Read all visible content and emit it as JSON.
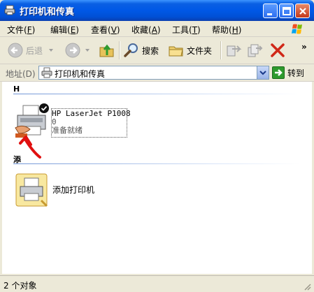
{
  "window": {
    "title": "打印机和传真",
    "controls": [
      "minimize",
      "maximize",
      "close"
    ]
  },
  "menu": {
    "items": [
      {
        "label": "文件(",
        "key": "F",
        "end": ")"
      },
      {
        "label": "编辑(",
        "key": "E",
        "end": ")"
      },
      {
        "label": "查看(",
        "key": "V",
        "end": ")"
      },
      {
        "label": "收藏(",
        "key": "A",
        "end": ")"
      },
      {
        "label": "工具(",
        "key": "T",
        "end": ")"
      },
      {
        "label": "帮助(",
        "key": "H",
        "end": ")"
      }
    ]
  },
  "toolbar": {
    "back_label": "后退",
    "search_label": "搜索",
    "folders_label": "文件夹",
    "overflow": "»"
  },
  "address": {
    "label": "地址(D)",
    "value": "打印机和传真",
    "go_label": "转到"
  },
  "groups": [
    {
      "header": "H",
      "items": [
        {
          "name": "HP LaserJet P1008",
          "line2": "0",
          "status": "准备就绪"
        }
      ]
    },
    {
      "header": "添",
      "items": [
        {
          "name": "添加打印机"
        }
      ]
    }
  ],
  "status": {
    "text": "2 个对象"
  },
  "colors": {
    "title_bar": "#0058e6",
    "close_button": "#d0522f",
    "go_button": "#2e9a2e",
    "annotation_arrow": "#e01010"
  }
}
